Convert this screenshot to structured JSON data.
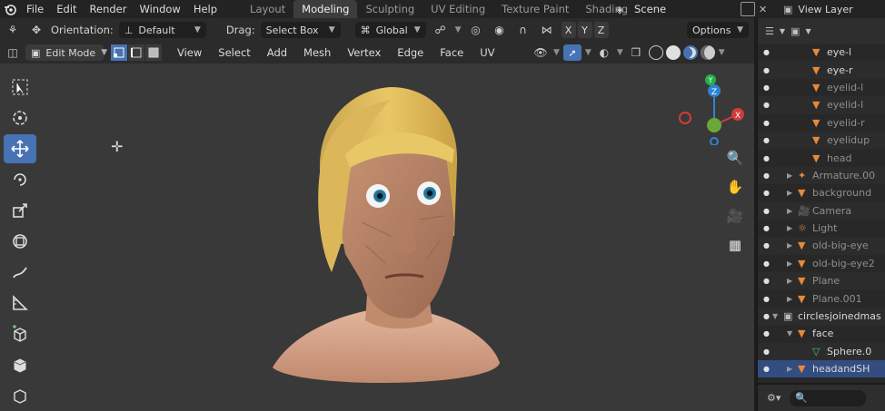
{
  "topbar": {
    "menus": [
      "File",
      "Edit",
      "Render",
      "Window",
      "Help"
    ],
    "workspaces": [
      "Layout",
      "Modeling",
      "Sculpting",
      "UV Editing",
      "Texture Paint",
      "Shading"
    ],
    "active_workspace": "Modeling",
    "scene": "Scene",
    "view_layer": "View Layer"
  },
  "tool_header": {
    "orientation_label": "Orientation:",
    "orientation_value": "Default",
    "drag_label": "Drag:",
    "drag_value": "Select Box",
    "transform_value": "Global",
    "axes": [
      "X",
      "Y",
      "Z"
    ],
    "options_label": "Options"
  },
  "viewport_header": {
    "mode": "Edit Mode",
    "menus": [
      "View",
      "Select",
      "Add",
      "Mesh",
      "Vertex",
      "Edge",
      "Face",
      "UV"
    ]
  },
  "gizmo": {
    "x": "X",
    "y": "Y",
    "z": "Z"
  },
  "outliner": {
    "rows": [
      {
        "label": "eye-l",
        "icon": "mesh-icon",
        "indent": 3,
        "dim": false
      },
      {
        "label": "eye-r",
        "icon": "mesh-icon",
        "indent": 3,
        "dim": false
      },
      {
        "label": "eyelid-l",
        "icon": "mesh-icon",
        "indent": 3,
        "dim": true
      },
      {
        "label": "eyelid-l",
        "icon": "mesh-icon",
        "indent": 3,
        "dim": true
      },
      {
        "label": "eyelid-r",
        "icon": "mesh-icon",
        "indent": 3,
        "dim": true
      },
      {
        "label": "eyelidup",
        "icon": "mesh-icon",
        "indent": 3,
        "dim": true
      },
      {
        "label": "head",
        "icon": "mesh-icon",
        "indent": 3,
        "dim": true
      },
      {
        "label": "Armature.00",
        "icon": "armature-icon",
        "indent": 2,
        "dim": true
      },
      {
        "label": "background",
        "icon": "mesh-icon",
        "indent": 2,
        "dim": true
      },
      {
        "label": "Camera",
        "icon": "camera-icon",
        "indent": 2,
        "dim": true
      },
      {
        "label": "Light",
        "icon": "light-icon",
        "indent": 2,
        "dim": true
      },
      {
        "label": "old-big-eye",
        "icon": "mesh-icon",
        "indent": 2,
        "dim": true
      },
      {
        "label": "old-big-eye2",
        "icon": "mesh-icon",
        "indent": 2,
        "dim": true
      },
      {
        "label": "Plane",
        "icon": "mesh-icon",
        "indent": 2,
        "dim": true
      },
      {
        "label": "Plane.001",
        "icon": "mesh-icon",
        "indent": 2,
        "dim": true
      },
      {
        "label": "circlesjoinedmas",
        "icon": "collection-icon",
        "indent": 1,
        "dim": false
      },
      {
        "label": "face",
        "icon": "mesh-icon",
        "indent": 2,
        "dim": false
      },
      {
        "label": "Sphere.0",
        "icon": "modifier-icon",
        "indent": 3,
        "dim": false
      },
      {
        "label": "headandSH",
        "icon": "mesh-icon",
        "indent": 2,
        "dim": false,
        "selected": true
      }
    ]
  }
}
